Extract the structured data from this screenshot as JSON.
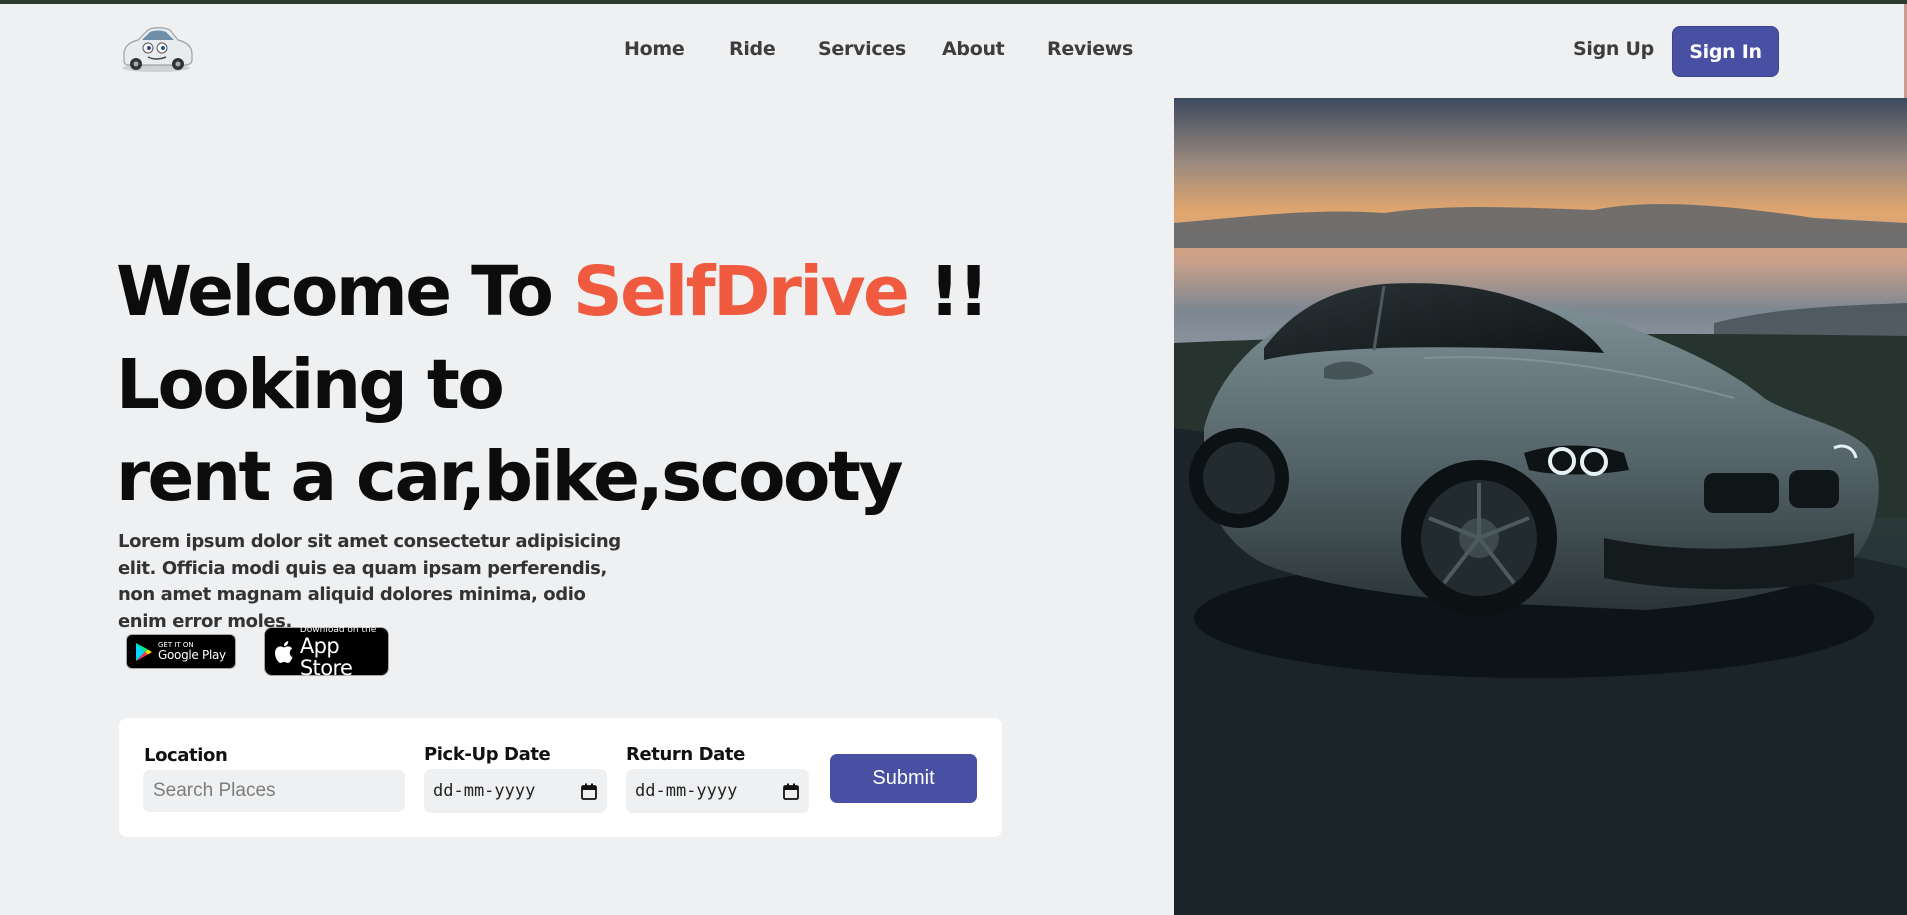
{
  "header": {
    "nav": [
      "Home",
      "Ride",
      "Services",
      "About",
      "Reviews"
    ],
    "sign_up": "Sign Up",
    "sign_in": "Sign In",
    "logo_icon": "car-logo-icon"
  },
  "hero": {
    "line1_prefix": "Welcome To ",
    "brand": "SelfDrive",
    "line1_suffix": " !!",
    "line2": "Looking to",
    "line3": "rent a car,bike,scooty",
    "paragraph": "Lorem ipsum dolor sit amet consectetur adipisicing elit. Officia modi quis ea quam ipsam perferendis, non amet magnam aliquid dolores minima, odio enim error moles."
  },
  "badges": {
    "google_small": "GET IT ON",
    "google_big": "Google Play",
    "apple_small": "Download on the",
    "apple_big": "App Store"
  },
  "form": {
    "location_label": "Location",
    "location_placeholder": "Search Places",
    "pickup_label": "Pick-Up Date",
    "pickup_value": "dd-mm-yyyy",
    "return_label": "Return Date",
    "return_value": "dd-mm-yyyy",
    "submit_label": "Submit"
  },
  "colors": {
    "accent": "#4750a3",
    "brand": "#f05a3e",
    "background": "#eef0f2"
  }
}
